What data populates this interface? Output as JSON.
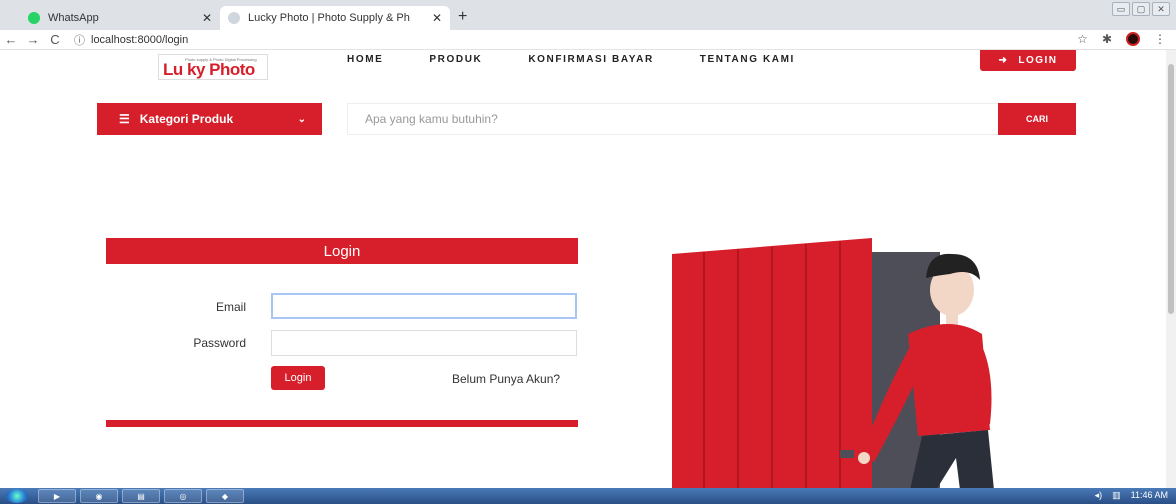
{
  "browser": {
    "tabs": [
      {
        "label": "WhatsApp",
        "active": false,
        "favicon_color": "#25d366"
      },
      {
        "label": "Lucky Photo | Photo Supply & Ph",
        "active": true,
        "favicon_color": "#cfd6de"
      }
    ],
    "url": "localhost:8000/login",
    "back": "←",
    "forward": "→",
    "reload": "C"
  },
  "site": {
    "logo_text": "Lu ky Photo",
    "logo_subtext": "Photo supply & Photo Digital Processing",
    "nav": [
      "HOME",
      "PRODUK",
      "KONFIRMASI BAYAR",
      "TENTANG KAMI"
    ],
    "login_button": "LOGIN",
    "category_button": "Kategori Produk",
    "search_placeholder": "Apa yang kamu butuhin?",
    "search_button": "CARI",
    "brand_color": "#d61f2b"
  },
  "login_form": {
    "title": "Login",
    "email_label": "Email",
    "email_value": "",
    "password_label": "Password",
    "password_value": "",
    "submit_label": "Login",
    "register_link": "Belum Punya Akun?"
  },
  "taskbar": {
    "clock": "11:46 AM"
  }
}
